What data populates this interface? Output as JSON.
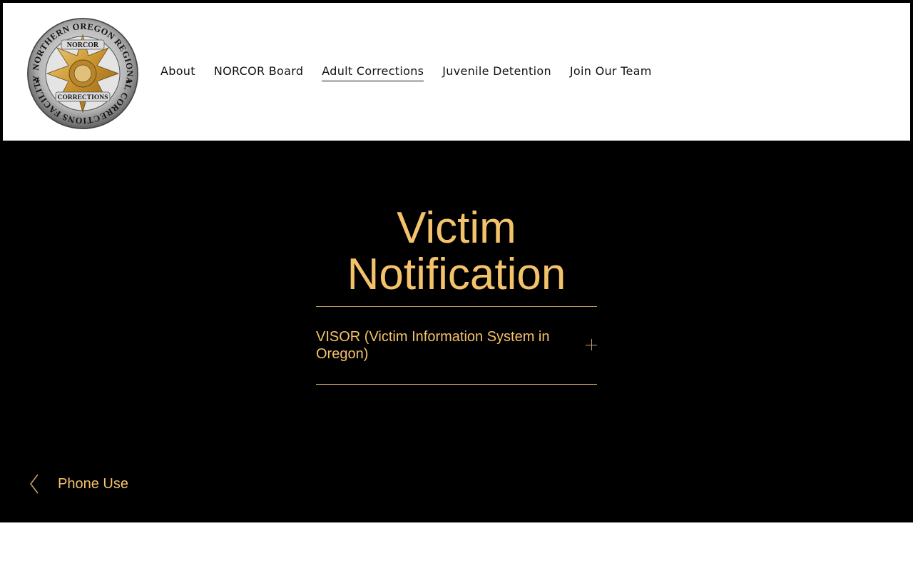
{
  "header": {
    "logo": {
      "icon": "norcor-badge-icon",
      "ring_text": "NORTHERN OREGON REGIONAL CORRECTIONS FACILITY",
      "banner_top": "NORCOR",
      "banner_bottom": "CORRECTIONS"
    },
    "nav": [
      {
        "label": "About",
        "active": false
      },
      {
        "label": "NORCOR Board",
        "active": false
      },
      {
        "label": "Adult Corrections",
        "active": true
      },
      {
        "label": "Juvenile Detention",
        "active": false
      },
      {
        "label": "Join Our Team",
        "active": false
      }
    ]
  },
  "main": {
    "title": "Victim Notification",
    "accordion": {
      "label": "VISOR (Victim Information System in Oregon)",
      "icon": "plus-icon",
      "expanded": false
    },
    "prev_link": {
      "label": "Phone Use",
      "icon": "chevron-left-icon"
    }
  },
  "colors": {
    "accent": "#f4c26b",
    "divider": "#c9a262",
    "hero_background": "#000000",
    "header_background": "#ffffff"
  }
}
